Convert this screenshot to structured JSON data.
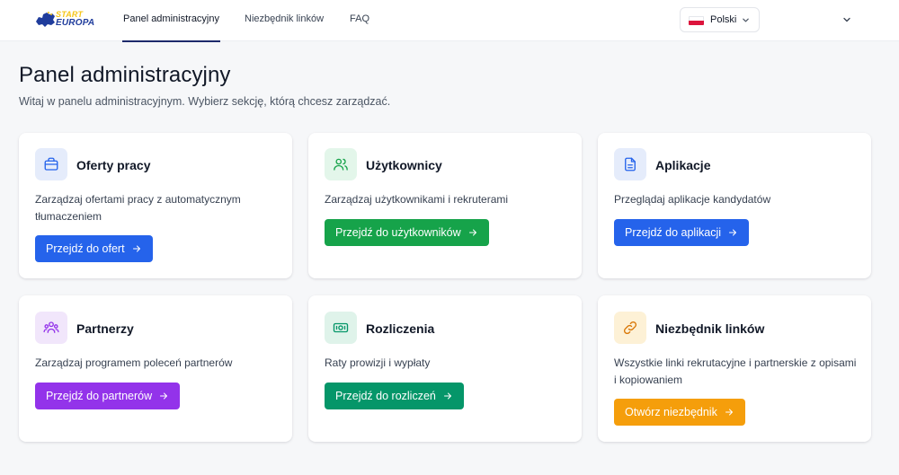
{
  "header": {
    "logo": {
      "line1": "START",
      "line2": "EUROPA"
    },
    "nav": [
      {
        "label": "Panel administracyjny",
        "active": true
      },
      {
        "label": "Niezbędnik linków",
        "active": false
      },
      {
        "label": "FAQ",
        "active": false
      }
    ],
    "language": {
      "label": "Polski",
      "flag": "poland-flag"
    }
  },
  "page": {
    "title": "Panel administracyjny",
    "subtitle": "Witaj w panelu administracyjnym. Wybierz sekcję, którą chcesz zarządzać."
  },
  "cards": [
    {
      "title": "Oferty pracy",
      "description": "Zarządzaj ofertami pracy z automatycznym tłumaczeniem",
      "button": "Przejdź do ofert",
      "icon": "briefcase-icon",
      "icon_bg": "#e5ecfb",
      "icon_color": "#2563eb",
      "button_color": "#2563eb"
    },
    {
      "title": "Użytkownicy",
      "description": "Zarządzaj użytkownikami i rekruterami",
      "button": "Przejdź do użytkowników",
      "icon": "users-icon",
      "icon_bg": "#e3f6ea",
      "icon_color": "#16a34a",
      "button_color": "#16a34a"
    },
    {
      "title": "Aplikacje",
      "description": "Przeglądaj aplikacje kandydatów",
      "button": "Przejdź do aplikacji",
      "icon": "document-icon",
      "icon_bg": "#e5ecfb",
      "icon_color": "#2563eb",
      "button_color": "#2563eb"
    },
    {
      "title": "Partnerzy",
      "description": "Zarządzaj programem poleceń partnerów",
      "button": "Przejdź do partnerów",
      "icon": "partners-icon",
      "icon_bg": "#f1e6fb",
      "icon_color": "#9333ea",
      "button_color": "#9333ea"
    },
    {
      "title": "Rozliczenia",
      "description": "Raty prowizji i wypłaty",
      "button": "Przejdź do rozliczeń",
      "icon": "banknote-icon",
      "icon_bg": "#dff3ea",
      "icon_color": "#059669",
      "button_color": "#059669"
    },
    {
      "title": "Niezbędnik linków",
      "description": "Wszystkie linki rekrutacyjne i partnerskie z opisami i kopiowaniem",
      "button": "Otwórz niezbędnik",
      "icon": "link-icon",
      "icon_bg": "#fdf1d6",
      "icon_color": "#d97706",
      "button_color": "#f59e0b"
    }
  ]
}
